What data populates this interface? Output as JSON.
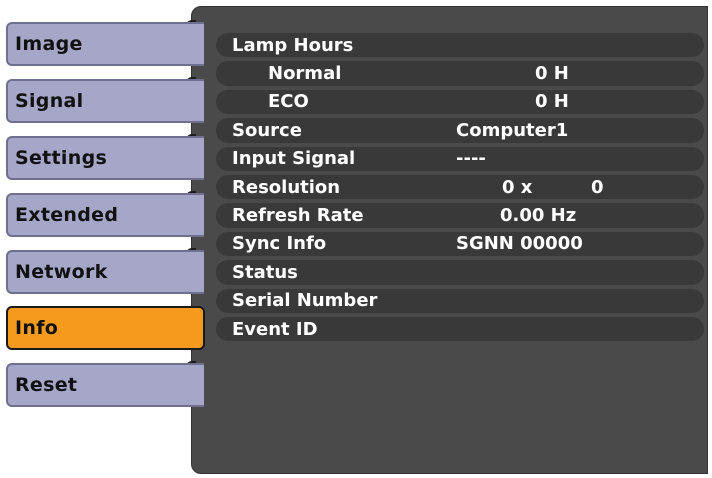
{
  "tabs": [
    {
      "label": "Image",
      "active": false
    },
    {
      "label": "Signal",
      "active": false
    },
    {
      "label": "Settings",
      "active": false
    },
    {
      "label": "Extended",
      "active": false
    },
    {
      "label": "Network",
      "active": false
    },
    {
      "label": "Info",
      "active": true
    },
    {
      "label": "Reset",
      "active": false
    }
  ],
  "info": {
    "lamp_hours": {
      "label": "Lamp Hours"
    },
    "normal": {
      "label": "Normal",
      "value": "0 H"
    },
    "eco": {
      "label": "ECO",
      "value": "0 H"
    },
    "source": {
      "label": "Source",
      "value": "Computer1"
    },
    "input_signal": {
      "label": "Input Signal",
      "value": "----"
    },
    "resolution": {
      "label": "Resolution",
      "value_x": "0 x",
      "value_y": "0"
    },
    "refresh_rate": {
      "label": "Refresh Rate",
      "value": "0.00 Hz"
    },
    "sync_info": {
      "label": "Sync Info",
      "value": "SGNN 00000"
    },
    "status": {
      "label": "Status",
      "value": ""
    },
    "serial_number": {
      "label": "Serial Number",
      "value": ""
    },
    "event_id": {
      "label": "Event ID",
      "value": ""
    }
  },
  "colors": {
    "tab_inactive": "#a6a6c8",
    "tab_active": "#f59a1c",
    "panel_bg": "#4a4a4a",
    "row_bg": "#393939",
    "text_light": "#ffffff",
    "text_dark": "#111111"
  }
}
